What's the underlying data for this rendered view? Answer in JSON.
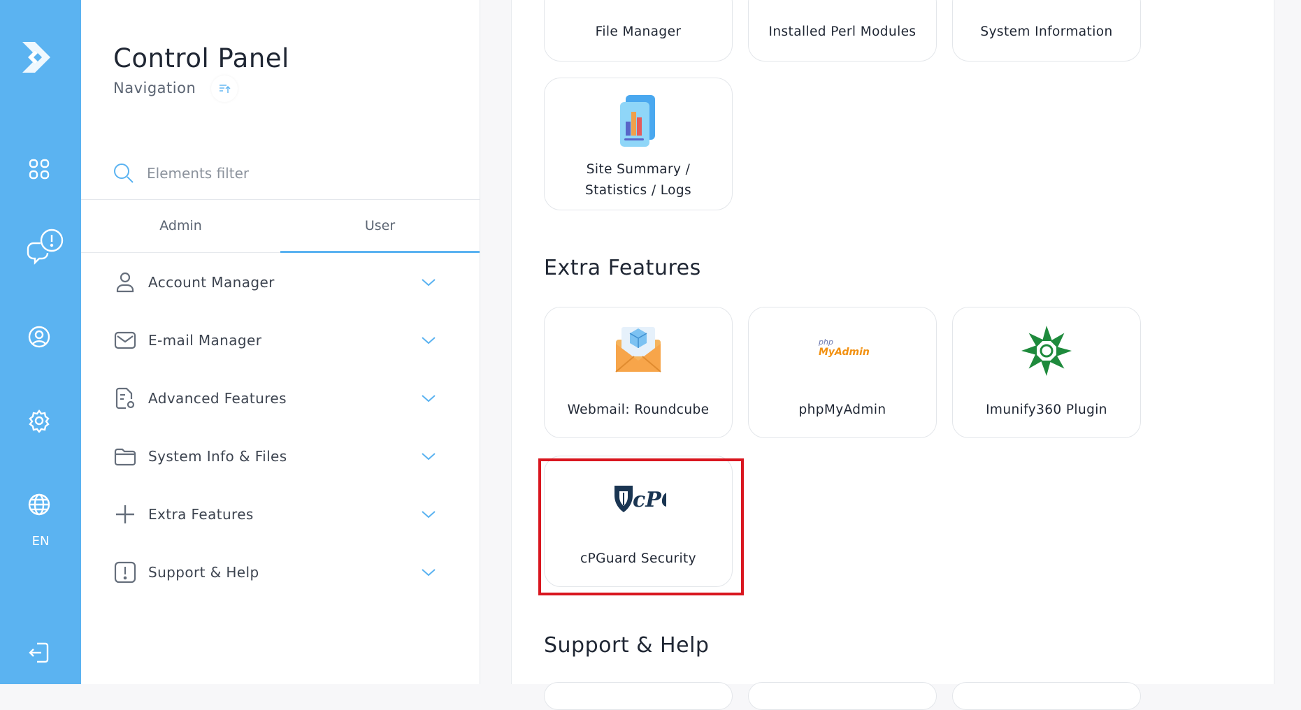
{
  "nav": {
    "title": "Control Panel",
    "subtitle": "Navigation",
    "filter_placeholder": "Elements filter",
    "tabs": [
      "Admin",
      "User"
    ],
    "active_tab": "User",
    "items": [
      {
        "label": "Account Manager",
        "icon": "user-icon"
      },
      {
        "label": "E-mail Manager",
        "icon": "envelope-icon"
      },
      {
        "label": "Advanced Features",
        "icon": "document-gear-icon"
      },
      {
        "label": "System Info & Files",
        "icon": "folder-icon"
      },
      {
        "label": "Extra Features",
        "icon": "plus-icon"
      },
      {
        "label": "Support & Help",
        "icon": "alert-box-icon"
      }
    ]
  },
  "rail": {
    "language": "EN"
  },
  "main": {
    "top_cards": [
      "File Manager",
      "Installed Perl Modules",
      "System Information"
    ],
    "site_summary": {
      "line1": "Site Summary /",
      "line2": "Statistics / Logs"
    },
    "extra_features_title": "Extra Features",
    "extra_cards": [
      "Webmail: Roundcube",
      "phpMyAdmin",
      "Imunify360 Plugin",
      "cPGuard Security"
    ],
    "phpmyadmin_logo": {
      "small": "php",
      "big": "MyAdmin"
    },
    "support_title": "Support & Help"
  },
  "colors": {
    "accent": "#5bb3f1",
    "highlight": "#d9161f",
    "imunify_green": "#1e8a3c",
    "cpguard_navy": "#1a3552"
  }
}
